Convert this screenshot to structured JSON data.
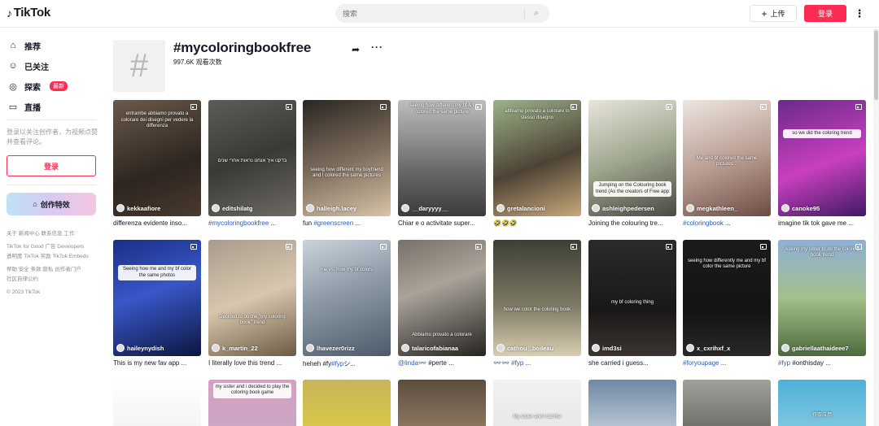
{
  "header": {
    "logo_text": "TikTok",
    "search_placeholder": "搜索",
    "upload_label": "上传",
    "login_label": "登录"
  },
  "sidebar": {
    "nav": [
      {
        "label": "推荐",
        "icon": "home-icon"
      },
      {
        "label": "已关注",
        "icon": "following-icon"
      },
      {
        "label": "探索",
        "icon": "explore-icon",
        "badge": "最新"
      },
      {
        "label": "直播",
        "icon": "live-icon"
      }
    ],
    "login_prompt": "登录以关注创作者，为视频点赞并查看评论。",
    "login_button": "登录",
    "effects_button": "创作特效",
    "footer": [
      "关于 新闻中心 联系信息 工作",
      "TikTok for Good 广告 Developers",
      "透明度 TikTok 奖励 TikTok Embeds",
      "帮助 安全 条款 隐私 创作者门户",
      "社区自律公约",
      "© 2023 TikTok"
    ]
  },
  "tag": {
    "title": "#mycoloringbookfree",
    "views": "997.6K 观看次数"
  },
  "videos": [
    {
      "author": "kekkaafiore",
      "desc": "differenza evidente inso...",
      "caption": "entrambe abbiamo provato a colorare dei disegni per vedere la differenza",
      "bg": "linear-gradient(160deg,#6b5a4a,#2d2520 60%,#4a3a2e)",
      "cap_top": "10%",
      "boxed": false
    },
    {
      "author": "editshilatg",
      "desc_tag": "#mycoloringbookfree",
      "desc": " ...",
      "caption": "בדקנו איך אנחנו נראות אחרי שנים",
      "bg": "linear-gradient(160deg,#5e5c58,#3a3936 50%,#6e6a64)",
      "cap_top": "50%",
      "boxed": false
    },
    {
      "author": "halleigh.lacey",
      "desc": "fun ",
      "desc_tag": "#greenscreen",
      "desc2": " ...",
      "caption": "seeing how different my boyfriend and I colored the same pictures",
      "bg": "linear-gradient(160deg,#2a2622,#7a6a5a 50%,#d8c3a8)",
      "cap_top": "58%",
      "boxed": false
    },
    {
      "author": "__daryyyy__",
      "desc": "Chiar e o activitate super...",
      "caption": "seeing how different my bf & I colored the same picture",
      "bg": "linear-gradient(180deg,#bdbdbd,#6a6a6a 60%,#3b3b3b)",
      "cap_top": "3%",
      "boxed": false
    },
    {
      "author": "gretalancioni",
      "desc": "🤣🤣🤣",
      "caption": "abbiamo provato a colorare lo stesso disegno",
      "bg": "linear-gradient(160deg,#9cb38a,#4d4335 55%,#c9a87a)",
      "cap_top": "8%",
      "boxed": false
    },
    {
      "author": "ashleighpedersen",
      "desc": "Joining the colouring tre...",
      "caption": "Jumping on the Colouring book trend (As the creators of Free app",
      "bg": "linear-gradient(160deg,#e8e4dc,#9ea68d 50%,#4a4a44)",
      "cap_top": "70%",
      "boxed": true
    },
    {
      "author": "megkathleen_",
      "desc_tag": "#coloringbook",
      "desc": " ...",
      "caption": "Me and bf colored the same pictures...",
      "bg": "linear-gradient(160deg,#ede6e1,#b79a8e 55%,#6a4c44)",
      "cap_top": "48%",
      "boxed": false
    },
    {
      "author": "canoke95",
      "desc": "imagine tik tok gave me ...",
      "caption": "so we did the coloring trend",
      "bg": "linear-gradient(160deg,#6a2a8a,#c93fbf 55%,#3e1a63)",
      "cap_top": "25%",
      "boxed": true
    },
    {
      "author": "haileynydish",
      "desc": "This is my new fav app ...",
      "caption": "Seeing how me and my bf color the same photos",
      "bg": "linear-gradient(160deg,#1b2e86,#3857c8 45%,#0d1540)",
      "cap_top": "22%",
      "boxed": true
    },
    {
      "author": "k_martin_22",
      "desc": "I literally love this trend ...",
      "caption": "Decided to do the \"my coloring book\" trend",
      "bg": "linear-gradient(160deg,#a89c8c,#d8c7ae 50%,#6d5a43)",
      "cap_top": "64%",
      "boxed": false
    },
    {
      "author": "lhavezer0rizz",
      "desc": "heheh #fy",
      "desc_tag": "#fyp",
      "desc2": "シ...",
      "caption": "me vs. how my bf colors",
      "bg": "linear-gradient(160deg,#c9d3dc,#8d9aa6 45%,#4c5a6a)",
      "cap_top": "24%",
      "boxed": false
    },
    {
      "author": "talaricofabianaa",
      "desc_tag": "@linda",
      "desc": "👓 ",
      "desc2": "#perte ...",
      "caption": "Abbiamo provato a colorare",
      "bg": "linear-gradient(160deg,#777068,#a9a39a 40%,#262320)",
      "cap_top": "80%",
      "boxed": false
    },
    {
      "author": "cathou_.boileau",
      "desc": "👓👓 ",
      "desc_tag": "#fyp",
      "desc2": " ...",
      "caption": "how we color the coloring book",
      "bg": "linear-gradient(180deg,#3e3f35,#7b7763 55%,#d8cdb0)",
      "cap_top": "58%",
      "boxed": false
    },
    {
      "author": "imd3si",
      "desc": "she carried i guess...",
      "caption": "my bf coloring thing",
      "bg": "linear-gradient(180deg,#2d2b29,#1a1817 60%,#3a3532)",
      "cap_top": "52%",
      "boxed": false
    },
    {
      "author": "x_cxrihxf_x",
      "desc_tag": "#foryoupage",
      "desc": " ...",
      "caption": "seeing how differently me and my bf color the same picture",
      "bg": "linear-gradient(180deg,#1c1b1a,#141312 60%,#2a2826)",
      "cap_top": "16%",
      "boxed": false
    },
    {
      "author": "gabriellaathaideee7",
      "desc_tag": "#fyp",
      "desc": " ",
      "desc2": "#onthisday ...",
      "caption": "Asking my sister to do the coloring book trend",
      "bg": "linear-gradient(180deg,#8eb0d8,#a3c08a 50%,#4d6a3c)",
      "cap_top": "6%",
      "boxed": false
    },
    {
      "author": "",
      "desc": "",
      "caption": "",
      "bg": "linear-gradient(180deg,#ffffff,#f4f4f4)",
      "cap_top": "40%",
      "boxed": false
    },
    {
      "author": "",
      "desc": "",
      "caption": "my sister and i decided to play the coloring book game",
      "bg": "linear-gradient(180deg,#d9a0c0,#caa6c6)",
      "cap_top": "6%",
      "boxed": true
    },
    {
      "author": "",
      "desc": "",
      "caption": "",
      "bg": "linear-gradient(180deg,#c9b45a,#d8c74a)",
      "cap_top": "40%",
      "boxed": false
    },
    {
      "author": "",
      "desc": "",
      "caption": "",
      "bg": "linear-gradient(180deg,#5e4d3f,#8c7661)",
      "cap_top": "40%",
      "boxed": false
    },
    {
      "author": "",
      "desc": "",
      "caption": "My sister and I did the",
      "bg": "linear-gradient(180deg,#f2f2f2,#e8e8e8)",
      "cap_top": "72%",
      "boxed": false
    },
    {
      "author": "",
      "desc": "",
      "caption": "",
      "bg": "linear-gradient(180deg,#6f88a6,#b9c6d3)",
      "cap_top": "40%",
      "boxed": false
    },
    {
      "author": "",
      "desc": "",
      "caption": "",
      "bg": "linear-gradient(180deg,#9ea29a,#6d7068)",
      "cap_top": "40%",
      "boxed": false
    },
    {
      "author": "",
      "desc": "",
      "caption": "获取应用",
      "bg": "linear-gradient(180deg,#4fb0d8,#7ec7e0)",
      "cap_top": "68%",
      "boxed": false
    }
  ]
}
